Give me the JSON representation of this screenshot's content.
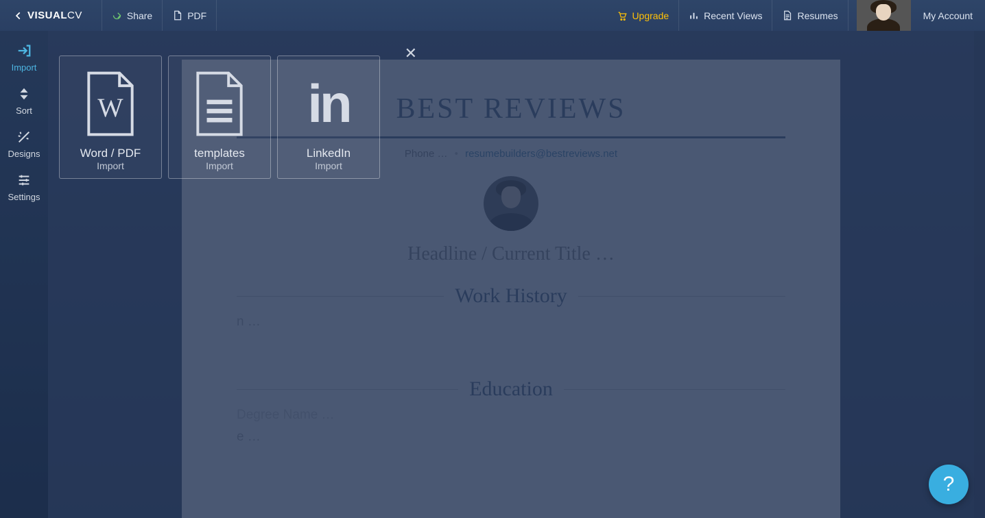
{
  "brand": {
    "name_bold": "VISUAL",
    "name_thin": "CV"
  },
  "topbar": {
    "share": "Share",
    "pdf": "PDF",
    "upgrade": "Upgrade",
    "recent_views": "Recent Views",
    "resumes": "Resumes",
    "my_account": "My Account"
  },
  "leftbar": {
    "import": "Import",
    "sort": "Sort",
    "designs": "Designs",
    "settings": "Settings"
  },
  "import_panel": {
    "cards": [
      {
        "title": "Word / PDF",
        "sub": "Import"
      },
      {
        "title": "templates",
        "sub": "Import"
      },
      {
        "title": "LinkedIn",
        "sub": "Import"
      }
    ]
  },
  "resume": {
    "title": "BEST REVIEWS",
    "phone_placeholder": "Phone …",
    "email": "resumebuilders@bestreviews.net",
    "headline_placeholder": "Headline / Current Title …",
    "sections": {
      "work": "Work History",
      "education": "Education"
    },
    "placeholders": {
      "line_a": "n …",
      "degree": "Degree Name …",
      "date": "e …"
    }
  },
  "help": "?"
}
